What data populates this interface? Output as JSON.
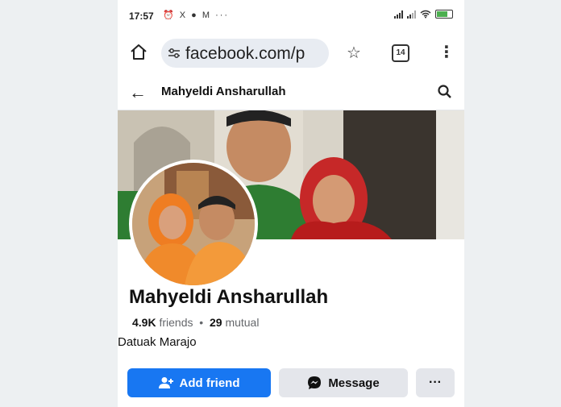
{
  "status_bar": {
    "time": "17:57",
    "left_icons": "⏰ X ● M ···"
  },
  "browser": {
    "url": "facebook.com/p",
    "tab_count": "14"
  },
  "header": {
    "title": "Mahyeldi Ansharullah"
  },
  "profile": {
    "name": "Mahyeldi Ansharullah",
    "friends_count": "4.9K",
    "friends_label": "friends",
    "separator": "•",
    "mutual_count": "29",
    "mutual_label": "mutual",
    "bio": "Datuak Marajo"
  },
  "actions": {
    "add_friend": "Add friend",
    "message": "Message",
    "more": "···"
  },
  "colors": {
    "accent": "#1877f2",
    "button_grey": "#e4e6eb"
  }
}
